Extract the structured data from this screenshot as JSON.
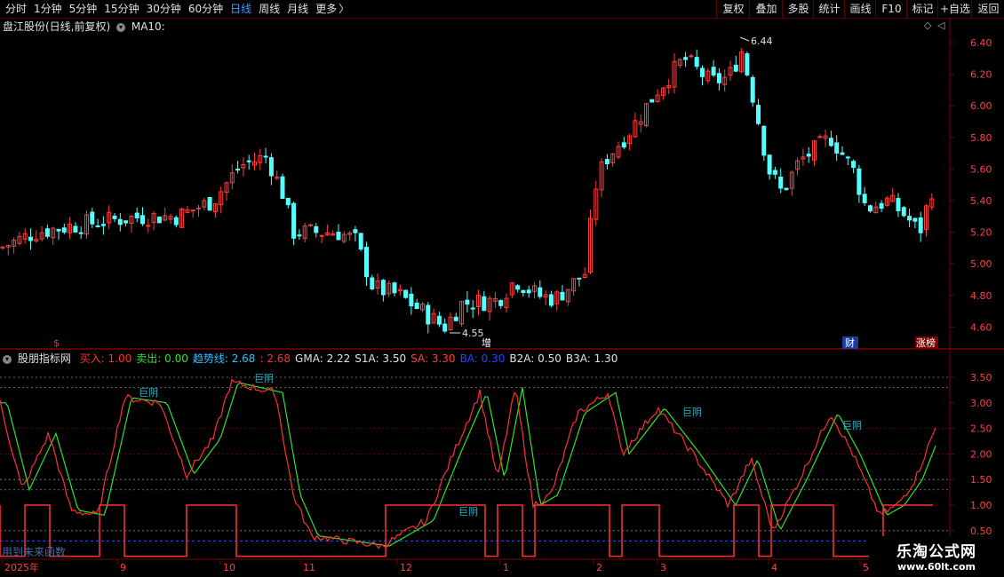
{
  "tabs": [
    "分时",
    "1分钟",
    "5分钟",
    "15分钟",
    "30分钟",
    "60分钟",
    "日线",
    "周线",
    "月线",
    "更多"
  ],
  "active_tab": "日线",
  "more_arrow": "〉",
  "right_buttons": [
    "复权",
    "叠加",
    "多股",
    "统计",
    "画线",
    "F10",
    "标记",
    "+自选",
    "返回"
  ],
  "main_pane": {
    "title": "盘江股份(日线,前复权)",
    "ma_label": "MA10:",
    "price_ticks": [
      "6.40",
      "6.20",
      "6.00",
      "5.80",
      "5.60",
      "5.40",
      "5.20",
      "5.00",
      "4.80",
      "4.60"
    ],
    "high_label": "6.44",
    "low_label": "4.55",
    "markers": [
      "$",
      "增",
      "财",
      "涨榜"
    ]
  },
  "indicator_pane": {
    "name": "股朋指标网",
    "items": [
      {
        "label": "买入:",
        "value": "1.00",
        "color": "#ff3030"
      },
      {
        "label": "卖出:",
        "value": "0.00",
        "color": "#30e030"
      },
      {
        "label": "趋势线:",
        "value": "2.68",
        "color": "#30c0ff"
      },
      {
        "label": ":",
        "value": "2.68",
        "color": "#ff3030"
      },
      {
        "label": "GMA:",
        "value": "2.22",
        "color": "#e0e0e0"
      },
      {
        "label": "S1A:",
        "value": "3.50",
        "color": "#e0e0e0"
      },
      {
        "label": "SA:",
        "value": "3.30",
        "color": "#ff4040"
      },
      {
        "label": "BA:",
        "value": "0.30",
        "color": "#3040ff"
      },
      {
        "label": "B2A:",
        "value": "0.50",
        "color": "#e0e0e0"
      },
      {
        "label": "B3A:",
        "value": "1.30",
        "color": "#e0e0e0"
      }
    ],
    "ticks": [
      "3.50",
      "3.00",
      "2.50",
      "2.00",
      "1.50",
      "1.00",
      "0.50"
    ],
    "annotations": [
      "巨阴",
      "巨阴",
      "巨阴",
      "巨阴",
      "巨阴"
    ],
    "watermark_text": "用到未来函数"
  },
  "date_axis": [
    "2025年",
    "9",
    "10",
    "11",
    "12",
    "1",
    "2",
    "3",
    "4",
    "5"
  ],
  "brand": {
    "name": "乐淘公式网",
    "url": "www.60lt.com"
  },
  "colors": {
    "up": "#ff3c3c",
    "down": "#54ffff",
    "border": "#7a0000",
    "axis_text": "#ff4040"
  }
}
